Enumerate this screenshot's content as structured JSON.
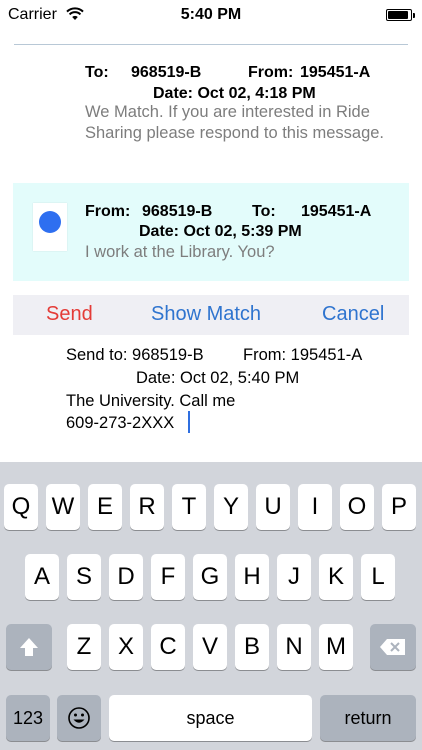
{
  "status_bar": {
    "carrier": "Carrier",
    "time": "5:40 PM",
    "battery_level": 0.9
  },
  "message1": {
    "to_label": "To:",
    "to_value": "968519-B",
    "from_label": "From:",
    "from_value": "195451-A",
    "date": "Date: Oct 02, 4:18 PM",
    "body": "We Match.  If you are interested in Ride Sharing please respond to this message."
  },
  "message2": {
    "from_label": "From:",
    "from_value": "968519-B",
    "to_label": "To:",
    "to_value": "195451-A",
    "date": "Date: Oct 02, 5:39 PM",
    "body": "I work at the Library. You?"
  },
  "actions": {
    "send": "Send",
    "show_match": "Show Match",
    "cancel": "Cancel"
  },
  "compose": {
    "send_to": "Send to: 968519-B",
    "from": "From: 195451-A",
    "date": "Date: Oct 02, 5:40 PM",
    "line1": "The University. Call me",
    "line2": "609-273-2XXX"
  },
  "keyboard": {
    "row1": [
      "Q",
      "W",
      "E",
      "R",
      "T",
      "Y",
      "U",
      "I",
      "O",
      "P"
    ],
    "row2": [
      "A",
      "S",
      "D",
      "F",
      "G",
      "H",
      "J",
      "K",
      "L"
    ],
    "row3": [
      "Z",
      "X",
      "C",
      "V",
      "B",
      "N",
      "M"
    ],
    "numbers": "123",
    "space": "space",
    "return": "return",
    "icons": {
      "shift": "shift-icon",
      "delete": "delete-icon",
      "emoji": "emoji-icon"
    }
  },
  "colors": {
    "send": "#e43b37",
    "accent": "#2f74cf",
    "message_highlight": "#e3fcfb",
    "avatar_dot": "#2e6ff0",
    "keyboard_bg": "#d2d5db"
  }
}
